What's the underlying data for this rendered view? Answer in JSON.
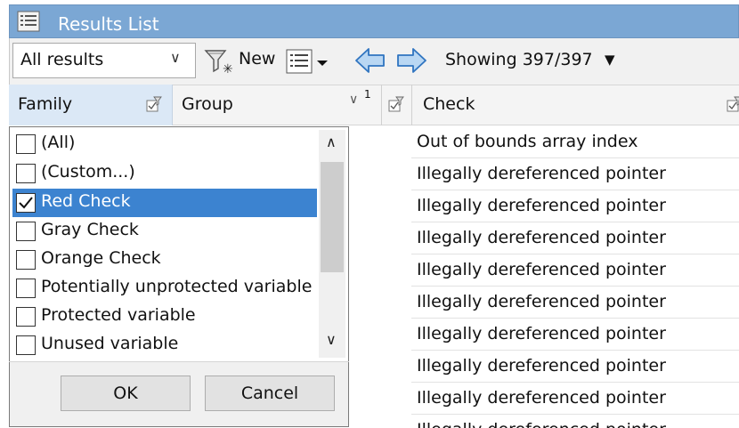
{
  "window": {
    "title": "Results List"
  },
  "toolbar": {
    "results_filter": "All results",
    "new_label": "New",
    "showing": "Showing 397/397"
  },
  "columns": {
    "family": "Family",
    "group": "Group",
    "group_sort_index": "1",
    "check": "Check"
  },
  "rows": [
    "Out of bounds array index",
    "Illegally dereferenced pointer",
    "Illegally dereferenced pointer",
    "Illegally dereferenced pointer",
    "Illegally dereferenced pointer",
    "Illegally dereferenced pointer",
    "Illegally dereferenced pointer",
    "Illegally dereferenced pointer",
    "Illegally dereferenced pointer",
    "Illegally dereferenced pointer"
  ],
  "filter_dropdown": {
    "items": [
      {
        "label": "(All)",
        "checked": false,
        "selected": false
      },
      {
        "label": "(Custom...)",
        "checked": false,
        "selected": false
      },
      {
        "label": "Red Check",
        "checked": true,
        "selected": true
      },
      {
        "label": "Gray Check",
        "checked": false,
        "selected": false
      },
      {
        "label": "Orange Check",
        "checked": false,
        "selected": false
      },
      {
        "label": "Potentially unprotected variable",
        "checked": false,
        "selected": false
      },
      {
        "label": "Protected variable",
        "checked": false,
        "selected": false
      },
      {
        "label": "Unused variable",
        "checked": false,
        "selected": false
      }
    ],
    "ok_label": "OK",
    "cancel_label": "Cancel"
  },
  "colors": {
    "titlebar": "#7ba7d4",
    "selection": "#3c83d0",
    "arrow_blue": "#4a90d9"
  },
  "icons": [
    "list-window-icon",
    "filter-new-icon",
    "view-menu-icon",
    "back-arrow-icon",
    "forward-arrow-icon",
    "column-filter-icon"
  ]
}
